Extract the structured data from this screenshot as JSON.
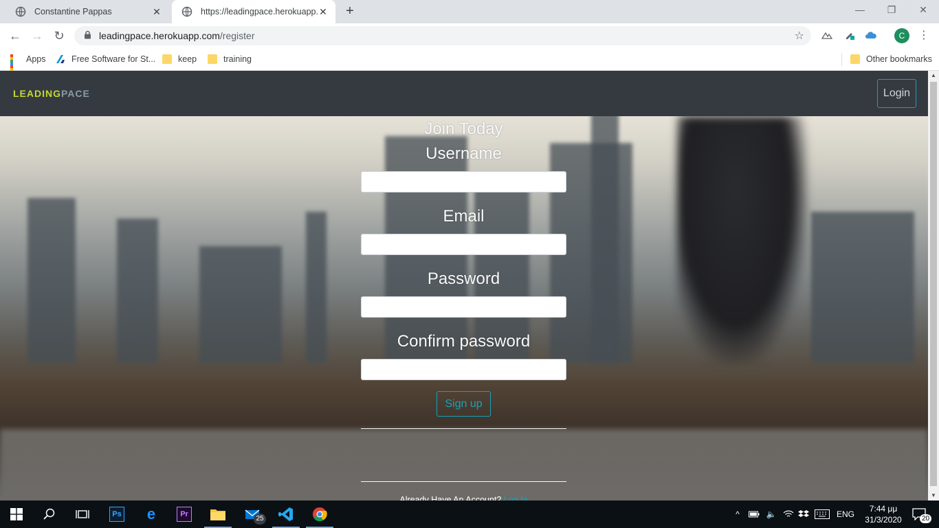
{
  "browser": {
    "tabs": [
      {
        "title": "Constantine Pappas",
        "active": false
      },
      {
        "title": "https://leadingpace.herokuapp.co",
        "active": true
      }
    ],
    "address": {
      "host": "leadingpace.herokuapp.com",
      "path": "/register"
    },
    "profile_initial": "C",
    "bookmarks": [
      {
        "label": "Apps",
        "icon": "apps-grid-icon"
      },
      {
        "label": "Free Software for St...",
        "icon": "autodesk-icon"
      },
      {
        "label": "keep",
        "icon": "folder-icon"
      },
      {
        "label": "training",
        "icon": "folder-icon"
      }
    ],
    "other_bookmarks": "Other bookmarks"
  },
  "site": {
    "brand_part1": "LEADING",
    "brand_part2": "PACE",
    "login_label": "Login",
    "form": {
      "heading": "Join Today",
      "username_label": "Username",
      "email_label": "Email",
      "password_label": "Password",
      "confirm_label": "Confirm password",
      "signup_label": "Sign up",
      "already_text": "Already Have An Account?",
      "login_link": "Log In"
    }
  },
  "taskbar": {
    "mail_badge": "25",
    "lang": "ENG",
    "time": "7:44 μμ",
    "date": "31/3/2020",
    "notifications": "20"
  },
  "colors": {
    "navbar": "#343a40",
    "accent": "#17a2b8",
    "brand_lime": "#c5d82e"
  }
}
